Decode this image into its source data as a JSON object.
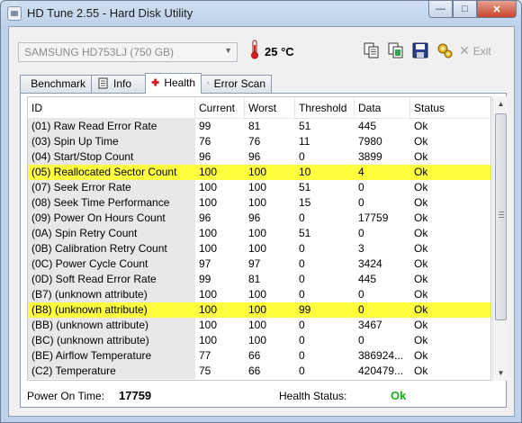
{
  "window": {
    "title": "HD Tune 2.55 - Hard Disk Utility",
    "minimize_glyph": "—",
    "maximize_glyph": "□",
    "close_glyph": "✕"
  },
  "toolbar": {
    "drive": "SAMSUNG HD753LJ (750 GB)",
    "temperature": "25 °C",
    "exit_label": "Exit",
    "icons": [
      "copy-text-icon",
      "copy-info-icon",
      "save-icon",
      "options-icon"
    ]
  },
  "tabs": [
    {
      "label": "Benchmark",
      "icon": "benchmark-icon"
    },
    {
      "label": "Info",
      "icon": "info-icon"
    },
    {
      "label": "Health",
      "icon": "health-icon",
      "active": true
    },
    {
      "label": "Error Scan",
      "icon": "error-scan-icon"
    }
  ],
  "table": {
    "columns": [
      "ID",
      "Current",
      "Worst",
      "Threshold",
      "Data",
      "Status"
    ],
    "rows": [
      {
        "id": "(01) Raw Read Error Rate",
        "current": "99",
        "worst": "81",
        "threshold": "51",
        "data": "445",
        "status": "Ok",
        "highlight": false
      },
      {
        "id": "(03) Spin Up Time",
        "current": "76",
        "worst": "76",
        "threshold": "11",
        "data": "7980",
        "status": "Ok",
        "highlight": false
      },
      {
        "id": "(04) Start/Stop Count",
        "current": "96",
        "worst": "96",
        "threshold": "0",
        "data": "3899",
        "status": "Ok",
        "highlight": false
      },
      {
        "id": "(05) Reallocated Sector Count",
        "current": "100",
        "worst": "100",
        "threshold": "10",
        "data": "4",
        "status": "Ok",
        "highlight": true
      },
      {
        "id": "(07) Seek Error Rate",
        "current": "100",
        "worst": "100",
        "threshold": "51",
        "data": "0",
        "status": "Ok",
        "highlight": false
      },
      {
        "id": "(08) Seek Time Performance",
        "current": "100",
        "worst": "100",
        "threshold": "15",
        "data": "0",
        "status": "Ok",
        "highlight": false
      },
      {
        "id": "(09) Power On Hours Count",
        "current": "96",
        "worst": "96",
        "threshold": "0",
        "data": "17759",
        "status": "Ok",
        "highlight": false
      },
      {
        "id": "(0A) Spin Retry Count",
        "current": "100",
        "worst": "100",
        "threshold": "51",
        "data": "0",
        "status": "Ok",
        "highlight": false
      },
      {
        "id": "(0B) Calibration Retry Count",
        "current": "100",
        "worst": "100",
        "threshold": "0",
        "data": "3",
        "status": "Ok",
        "highlight": false
      },
      {
        "id": "(0C) Power Cycle Count",
        "current": "97",
        "worst": "97",
        "threshold": "0",
        "data": "3424",
        "status": "Ok",
        "highlight": false
      },
      {
        "id": "(0D) Soft Read Error Rate",
        "current": "99",
        "worst": "81",
        "threshold": "0",
        "data": "445",
        "status": "Ok",
        "highlight": false
      },
      {
        "id": "(B7) (unknown attribute)",
        "current": "100",
        "worst": "100",
        "threshold": "0",
        "data": "0",
        "status": "Ok",
        "highlight": false
      },
      {
        "id": "(B8) (unknown attribute)",
        "current": "100",
        "worst": "100",
        "threshold": "99",
        "data": "0",
        "status": "Ok",
        "highlight": true
      },
      {
        "id": "(BB) (unknown attribute)",
        "current": "100",
        "worst": "100",
        "threshold": "0",
        "data": "3467",
        "status": "Ok",
        "highlight": false
      },
      {
        "id": "(BC) (unknown attribute)",
        "current": "100",
        "worst": "100",
        "threshold": "0",
        "data": "0",
        "status": "Ok",
        "highlight": false
      },
      {
        "id": "(BE) Airflow Temperature",
        "current": "77",
        "worst": "66",
        "threshold": "0",
        "data": "386924...",
        "status": "Ok",
        "highlight": false
      },
      {
        "id": "(C2) Temperature",
        "current": "75",
        "worst": "66",
        "threshold": "0",
        "data": "420479...",
        "status": "Ok",
        "highlight": false
      }
    ]
  },
  "footer": {
    "power_on_label": "Power On Time:",
    "power_on_value": "17759",
    "health_label": "Health Status:",
    "health_value": "Ok"
  },
  "colors": {
    "highlight": "#ffff40",
    "health_ok": "#18b018",
    "temperature_icon": "#d81e1e"
  }
}
